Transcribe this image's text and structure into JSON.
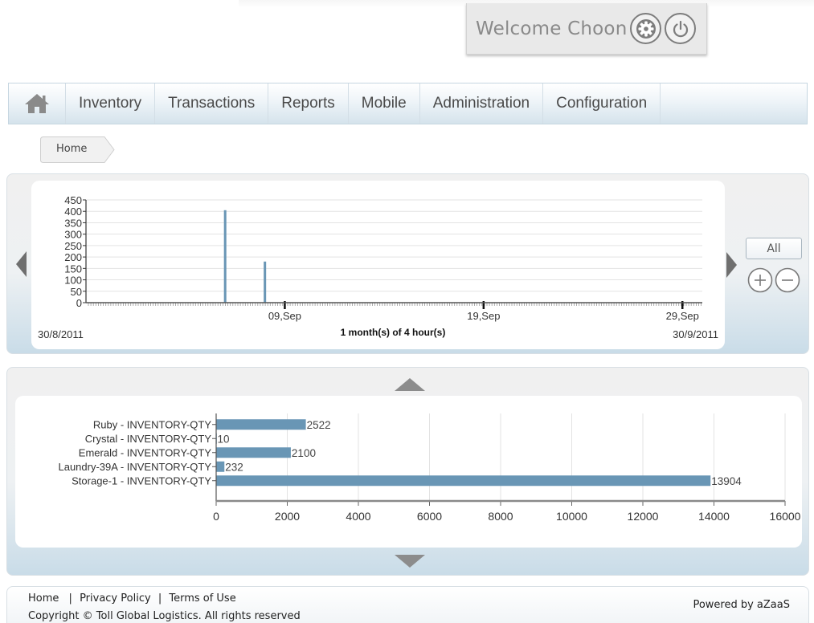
{
  "header": {
    "welcome_text": "Welcome Choon"
  },
  "icons": {
    "settings": "gear-icon",
    "logout": "power-icon",
    "home": "home-icon"
  },
  "nav": {
    "items": [
      {
        "label": "Inventory"
      },
      {
        "label": "Transactions"
      },
      {
        "label": "Reports"
      },
      {
        "label": "Mobile"
      },
      {
        "label": "Administration"
      },
      {
        "label": "Configuration"
      }
    ]
  },
  "breadcrumb": {
    "label": "Home"
  },
  "timeline": {
    "all_label": "All",
    "start_date": "30/8/2011",
    "end_date": "30/9/2011",
    "range_label": "1 month(s) of 4 hour(s)"
  },
  "colors": {
    "bar": "#6996b5",
    "nav_text": "#4a4a4a",
    "welcome_text": "#8a8a8a"
  },
  "chart_data": [
    {
      "type": "bar",
      "x_ticks": [
        "09,Sep",
        "19,Sep",
        "29,Sep"
      ],
      "y_ticks": [
        0,
        50,
        100,
        150,
        200,
        250,
        300,
        350,
        400,
        450
      ],
      "ylim": [
        0,
        450
      ],
      "x_range": [
        "30/8/2011",
        "30/9/2011"
      ],
      "points": [
        {
          "x": "2011-09-06",
          "y": 405
        },
        {
          "x": "2011-09-08",
          "y": 180
        }
      ],
      "grid": true
    },
    {
      "type": "bar",
      "orientation": "horizontal",
      "categories": [
        "Ruby - INVENTORY-QTY",
        "Crystal - INVENTORY-QTY",
        "Emerald - INVENTORY-QTY",
        "Laundry-39A - INVENTORY-QTY",
        "Storage-1 - INVENTORY-QTY"
      ],
      "values": [
        2522,
        10,
        2100,
        232,
        13904
      ],
      "xlim": [
        0,
        16000
      ],
      "x_ticks": [
        0,
        2000,
        4000,
        6000,
        8000,
        10000,
        12000,
        14000,
        16000
      ],
      "grid": true
    }
  ],
  "footer": {
    "link_home": "Home",
    "link_privacy": "Privacy Policy",
    "link_terms": "Terms of Use",
    "separator": "|",
    "copyright": "Copyright © Toll Global Logistics. All rights reserved",
    "powered_by": "Powered by aZaaS"
  }
}
